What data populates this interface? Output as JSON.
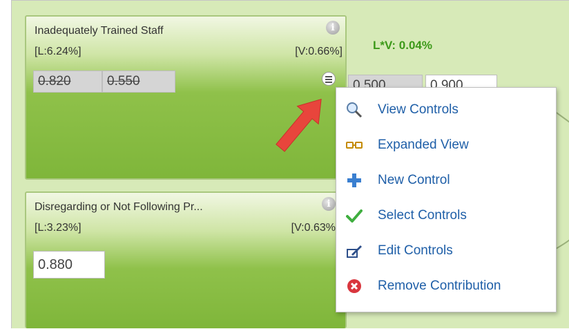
{
  "card1": {
    "title": "Inadequately Trained Staff",
    "l_value": "[L:6.24%]",
    "v_value": "[V:0.66%]",
    "old_value_1": "0.820",
    "old_value_2": "0.550",
    "lv_text": "L*V: 0.04%",
    "value_1_partial": "0.500",
    "value_2_partial": "0.900"
  },
  "card2": {
    "title": "Disregarding or Not Following Pr...",
    "l_value": "[L:3.23%]",
    "v_value": "[V:0.63%",
    "input_value": "0.880"
  },
  "info_glyph": "i",
  "context_menu": {
    "items": [
      {
        "label": "View Controls",
        "icon": "magnifier-icon"
      },
      {
        "label": "Expanded View",
        "icon": "glasses-icon"
      },
      {
        "label": "New Control",
        "icon": "plus-icon"
      },
      {
        "label": "Select Controls",
        "icon": "checkmark-icon"
      },
      {
        "label": "Edit Controls",
        "icon": "edit-pen-icon"
      },
      {
        "label": "Remove Contribution",
        "icon": "remove-x-icon"
      }
    ]
  },
  "colors": {
    "card_green": "#7fb63a",
    "canvas_green": "#d7eab8",
    "lv_green": "#3d9a1a",
    "menu_link": "#1f5fa8",
    "annotation_arrow": "#e8453c"
  }
}
